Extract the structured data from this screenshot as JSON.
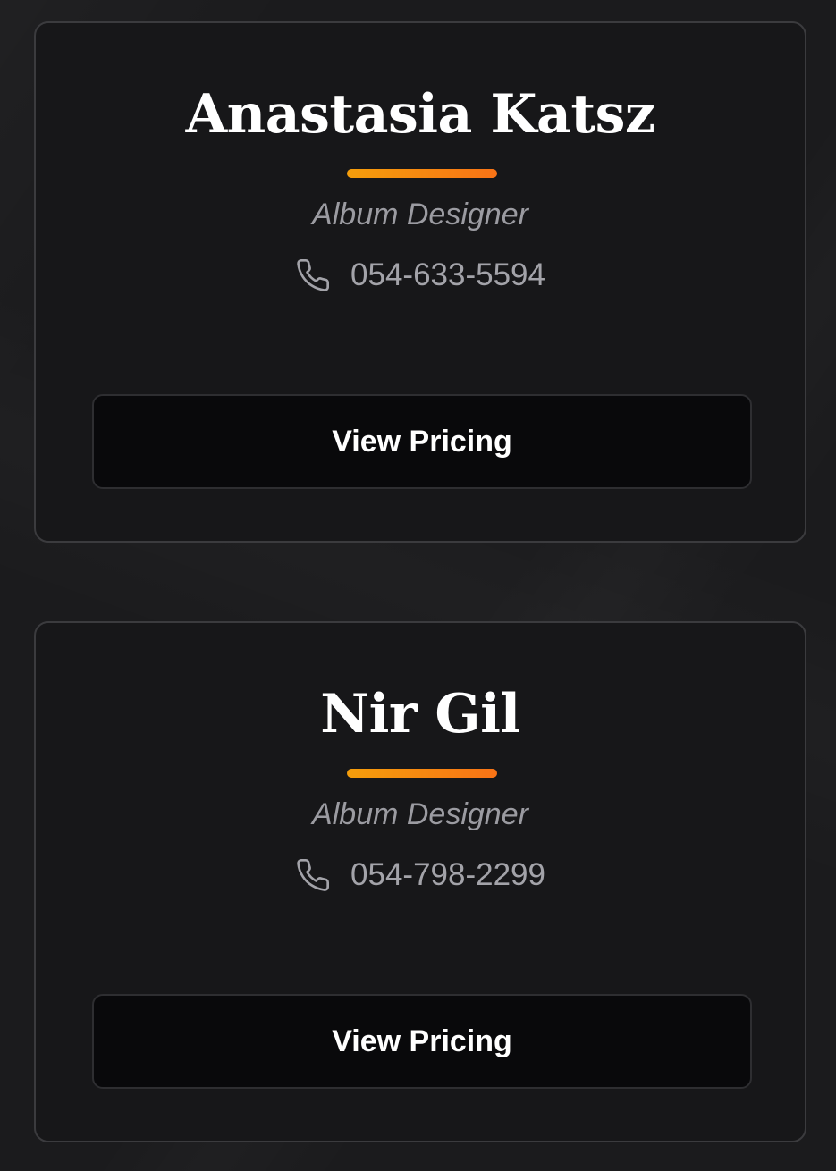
{
  "cards": [
    {
      "name": "Anastasia Katsz",
      "role": "Album Designer",
      "phone": "054-633-5594",
      "button_label": "View Pricing",
      "icon": "phone-icon"
    },
    {
      "name": "Nir Gil",
      "role": "Album Designer",
      "phone": "054-798-2299",
      "button_label": "View Pricing",
      "icon": "phone-icon"
    }
  ],
  "colors": {
    "background": "#1b1b1d",
    "card": "#171719",
    "card_border": "#3b3b3e",
    "accent_start": "#f59e0b",
    "accent_end": "#f97316",
    "button_bg": "#09090b",
    "muted_text": "#9b9ba1"
  }
}
